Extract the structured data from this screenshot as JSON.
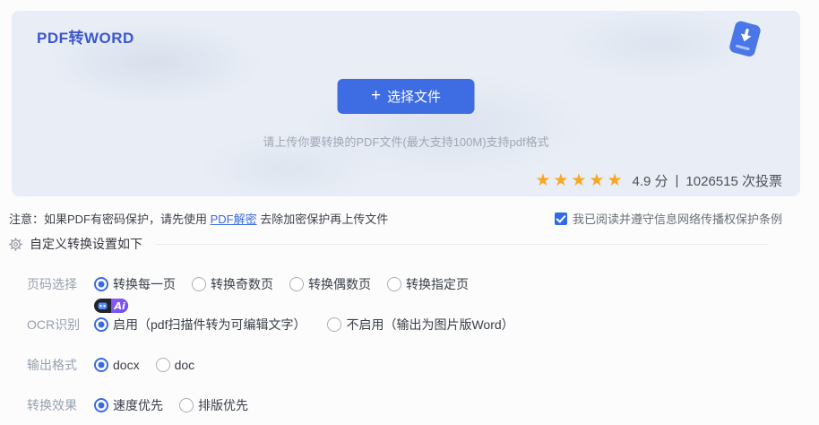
{
  "banner": {
    "title": "PDF转WORD",
    "upload_button": {
      "icon": "+",
      "label": "选择文件"
    },
    "hint": "请上传你要转换的PDF文件(最大支持100M)支持pdf格式",
    "rating": {
      "stars": "★★★★★",
      "score": "4.9 分",
      "divider": "|",
      "votes": "1026515 次投票"
    }
  },
  "notice": {
    "prefix": "注意：如果PDF有密码保护，请先使用 ",
    "link": "PDF解密",
    "suffix": " 去除加密保护再上传文件"
  },
  "agreement": {
    "label": "我已阅读并遵守信息网络传播权保护条例",
    "checked": true
  },
  "settings": {
    "title": "自定义转换设置如下",
    "badge": "Ai",
    "rows": [
      {
        "label": "页码选择",
        "options": [
          {
            "label": "转换每一页",
            "selected": true
          },
          {
            "label": "转换奇数页",
            "selected": false
          },
          {
            "label": "转换偶数页",
            "selected": false
          },
          {
            "label": "转换指定页",
            "selected": false
          }
        ]
      },
      {
        "label": "OCR识别",
        "options": [
          {
            "label": "启用（pdf扫描件转为可编辑文字）",
            "selected": true
          },
          {
            "label": "不启用（输出为图片版Word）",
            "selected": false
          }
        ]
      },
      {
        "label": "输出格式",
        "options": [
          {
            "label": "docx",
            "selected": true
          },
          {
            "label": "doc",
            "selected": false
          }
        ]
      },
      {
        "label": "转换效果",
        "options": [
          {
            "label": "速度优先",
            "selected": true
          },
          {
            "label": "排版优先",
            "selected": false
          }
        ]
      }
    ]
  },
  "colors": {
    "accent": "#3c6ae0",
    "star": "#f8a623",
    "banner_bg": "#e9eef6",
    "title_blue": "#3b57ce"
  }
}
